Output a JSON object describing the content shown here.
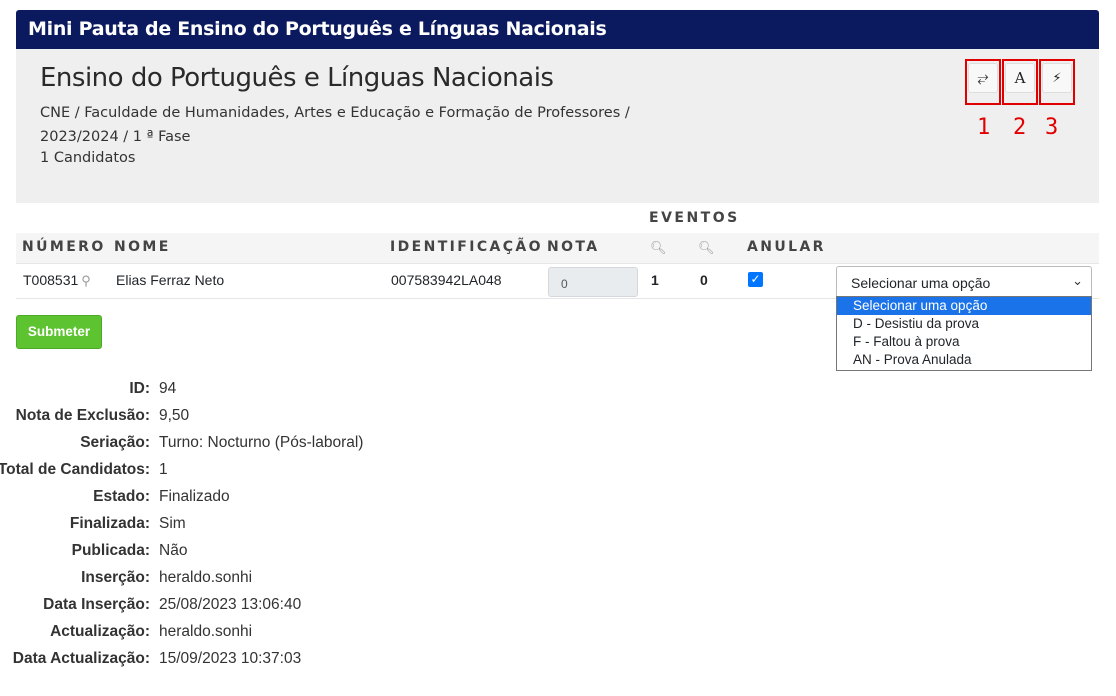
{
  "title_bar": "Mini Pauta de Ensino do Português e Línguas Nacionais",
  "header": {
    "title": "Ensino do Português e Línguas Nacionais",
    "path_line1": "CNE / Faculdade de Humanidades, Artes e Educação e Formação de Professores /",
    "path_line2": "2023/2024 / 1 ª Fase",
    "candidates": "1 Candidatos"
  },
  "toolbar": {
    "buttons": [
      {
        "icon": "text-wrap-icon",
        "glyph": "⥂",
        "annotation": "1"
      },
      {
        "icon": "font-icon",
        "glyph": "A",
        "annotation": "2"
      },
      {
        "icon": "bolt-icon",
        "glyph": "⚡",
        "annotation": "3"
      }
    ]
  },
  "table": {
    "group_header": "EVENTOS",
    "columns": {
      "numero": "NÚMERO",
      "nome": "NOME",
      "identificacao": "IDENTIFICAÇÃO",
      "nota": "NOTA",
      "anular": "ANULAR"
    },
    "rows": [
      {
        "numero": "T008531",
        "nome": "Elias Ferraz Neto",
        "identificacao": "007583942LA048",
        "nota_placeholder": "0",
        "evento1": "1",
        "evento2": "0",
        "anular_checked": true,
        "select_value": "Selecionar uma opção"
      }
    ]
  },
  "dropdown": {
    "options": [
      "Selecionar uma opção",
      "D - Desistiu da prova",
      "F - Faltou à prova",
      "AN - Prova Anulada"
    ],
    "selected_index": 0
  },
  "submit_label": "Submeter",
  "details": [
    {
      "label": "ID:",
      "value": "94"
    },
    {
      "label": "Nota de Exclusão:",
      "value": "9,50"
    },
    {
      "label": "Seriação:",
      "value": "Turno: Nocturno (Pós-laboral)"
    },
    {
      "label": "Total de Candidatos:",
      "value": "1"
    },
    {
      "label": "Estado:",
      "value": "Finalizado"
    },
    {
      "label": "Finalizada:",
      "value": "Sim"
    },
    {
      "label": "Publicada:",
      "value": "Não"
    },
    {
      "label": "Inserção:",
      "value": "heraldo.sonhi"
    },
    {
      "label": "Data Inserção:",
      "value": "25/08/2023 13:06:40"
    },
    {
      "label": "Actualização:",
      "value": "heraldo.sonhi"
    },
    {
      "label": "Data Actualização:",
      "value": "15/09/2023 10:37:03"
    }
  ],
  "colors": {
    "title_bar": "#0b1a5e",
    "submit": "#5ec330",
    "annotation": "#e00000",
    "dropdown_selected": "#1a73e8"
  }
}
